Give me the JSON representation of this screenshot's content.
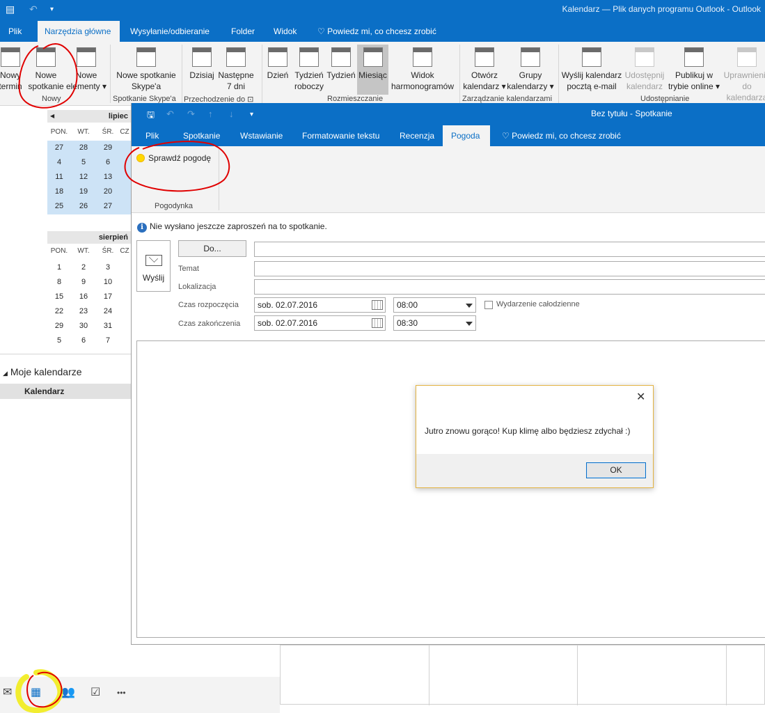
{
  "outer": {
    "title": "Kalendarz — Plik danych programu Outlook - Outlook",
    "tabs": [
      "Plik",
      "Narzędzia główne",
      "Wysyłanie/odbieranie",
      "Folder",
      "Widok"
    ],
    "tell_me": "Powiedz mi, co chcesz zrobić",
    "ribbon": {
      "new_term_l1": "Nowy",
      "new_term_l2": "termin",
      "new_meeting_l1": "Nowe",
      "new_meeting_l2": "spotkanie",
      "new_items_l1": "Nowe",
      "new_items_l2": "elementy",
      "group_new": "Nowy",
      "skype_l1": "Nowe spotkanie",
      "skype_l2": "Skype'a",
      "group_skype": "Spotkanie Skype'a",
      "today": "Dzisiaj",
      "next7_l1": "Następne",
      "next7_l2": "7 dni",
      "group_goto": "Przechodzenie do",
      "day": "Dzień",
      "workweek_l1": "Tydzień",
      "workweek_l2": "roboczy",
      "week": "Tydzień",
      "month": "Miesiąc",
      "schedule_l1": "Widok",
      "schedule_l2": "harmonogramów",
      "group_arrange": "Rozmieszczanie",
      "open_cal_l1": "Otwórz",
      "open_cal_l2": "kalendarz",
      "cal_groups_l1": "Grupy",
      "cal_groups_l2": "kalendarzy",
      "group_manage": "Zarządzanie kalendarzami",
      "email_cal_l1": "Wyślij kalendarz",
      "email_cal_l2": "pocztą e-mail",
      "share_l1": "Udostępnij",
      "share_l2": "kalendarz",
      "publish_l1": "Publikuj w",
      "publish_l2": "trybie online",
      "perm_l1": "Uprawnienia",
      "perm_l2": "do kalendarza",
      "group_share": "Udostępnianie"
    }
  },
  "left": {
    "month1": "lipiec",
    "month2": "sierpień",
    "dow": [
      "PON.",
      "WT.",
      "ŚR.",
      "CZ"
    ],
    "month1_days": [
      [
        "27",
        "28",
        "29"
      ],
      [
        "4",
        "5",
        "6"
      ],
      [
        "11",
        "12",
        "13"
      ],
      [
        "18",
        "19",
        "20"
      ],
      [
        "25",
        "26",
        "27"
      ]
    ],
    "month2_days": [
      [
        "1",
        "2",
        "3"
      ],
      [
        "8",
        "9",
        "10"
      ],
      [
        "15",
        "16",
        "17"
      ],
      [
        "22",
        "23",
        "24"
      ],
      [
        "29",
        "30",
        "31"
      ],
      [
        "5",
        "6",
        "7"
      ]
    ],
    "my_calendars": "Moje kalendarze",
    "calendar_item": "Kalendarz",
    "more": "•••"
  },
  "meeting": {
    "window_title": "Bez tytułu - Spotkanie",
    "tabs": [
      "Plik",
      "Spotkanie",
      "Wstawianie",
      "Formatowanie tekstu",
      "Recenzja",
      "Pogoda"
    ],
    "tell_me": "Powiedz mi, co chcesz zrobić",
    "check_weather": "Sprawdź pogodę",
    "group_weather": "Pogodynka",
    "info": "Nie wysłano jeszcze zaproszeń na to spotkanie.",
    "send": "Wyślij",
    "to_button": "Do...",
    "subject_label": "Temat",
    "location_label": "Lokalizacja",
    "start_label": "Czas rozpoczęcia",
    "end_label": "Czas zakończenia",
    "start_date": "sob. 02.07.2016",
    "start_time": "08:00",
    "end_date": "sob. 02.07.2016",
    "end_time": "08:30",
    "all_day": "Wydarzenie całodzienne"
  },
  "dialog": {
    "message": "Jutro znowu gorąco! Kup klimę albo będziesz zdychał :)",
    "ok": "OK",
    "close": "✕"
  }
}
